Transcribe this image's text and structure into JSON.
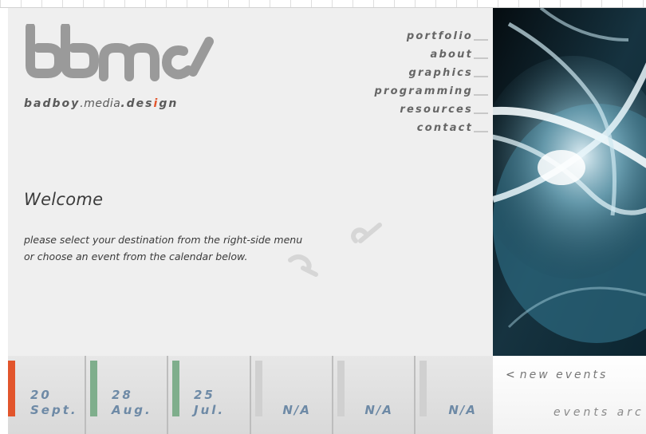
{
  "brand": {
    "tagline_bold1": "badboy",
    "tagline_dot1": ".",
    "tagline_media": "media",
    "tagline_dot2": ".",
    "tagline_des": "des",
    "tagline_i": "i",
    "tagline_gn": "gn",
    "logo_icon": "bbmc-logo",
    "logo_color": "#9a9a9a",
    "accent_color": "#e2552c"
  },
  "nav": {
    "items": [
      {
        "label": "portfolio"
      },
      {
        "label": "about"
      },
      {
        "label": "graphics"
      },
      {
        "label": "programming"
      },
      {
        "label": "resources"
      },
      {
        "label": "contact"
      }
    ]
  },
  "welcome": {
    "title": "Welcome",
    "line1": "please select your destination from the right-side menu",
    "line2": "or choose an event from the calendar below."
  },
  "calendar": {
    "cells": [
      {
        "date": "20\nSept.",
        "bar_color": "#e2552c"
      },
      {
        "date": "28\nAug.",
        "bar_color": "#7fae8c"
      },
      {
        "date": "25\nJul.",
        "bar_color": "#7fae8c"
      },
      {
        "date": "N/A",
        "bar_color": "#d0d0d0"
      },
      {
        "date": "N/A",
        "bar_color": "#d0d0d0"
      },
      {
        "date": "N/A",
        "bar_color": "#d0d0d0"
      }
    ]
  },
  "events": {
    "prev_glyph": "<",
    "nav_label": "new events",
    "truncated_text": "events arc"
  }
}
